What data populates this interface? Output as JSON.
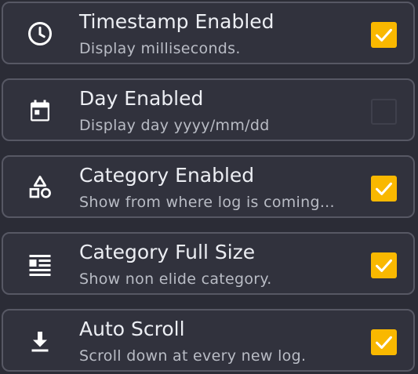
{
  "colors": {
    "background": "#2b2c36",
    "row_background": "#31323d",
    "row_border": "#575864",
    "checkbox_checked": "#f9b800",
    "checkbox_unchecked_border": "#3f404c",
    "title_text": "#eceef3",
    "subtitle_text": "#b9bcc5"
  },
  "settings": [
    {
      "title": "Timestamp Enabled",
      "subtitle": "Display milliseconds.",
      "icon": "clock-icon",
      "checked": true
    },
    {
      "title": "Day Enabled",
      "subtitle": "Display day yyyy/mm/dd",
      "icon": "calendar-icon",
      "checked": false
    },
    {
      "title": "Category Enabled",
      "subtitle": "Show from where log is coming...",
      "icon": "category-shapes-icon",
      "checked": true
    },
    {
      "title": "Category Full Size",
      "subtitle": "Show non elide category.",
      "icon": "wrap-text-icon",
      "checked": true
    },
    {
      "title": "Auto Scroll",
      "subtitle": "Scroll down at every new log.",
      "icon": "download-icon",
      "checked": true
    }
  ]
}
